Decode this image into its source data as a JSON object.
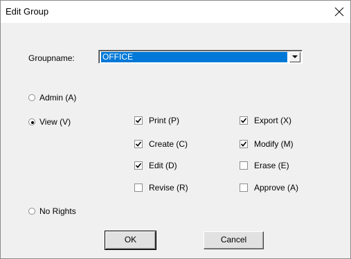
{
  "window": {
    "title": "Edit Group",
    "close_icon": "close-icon"
  },
  "groupname": {
    "label": "Groupname:",
    "selected_value": "OFFICE",
    "arrow_icon": "chevron-down-icon"
  },
  "rights": {
    "admin": {
      "label": "Admin (A)",
      "selected": false
    },
    "view": {
      "label": "View (V)",
      "selected": true
    },
    "no_rights": {
      "label": "No Rights",
      "selected": false
    }
  },
  "permissions": {
    "print": {
      "label": "Print (P)",
      "checked": true
    },
    "create": {
      "label": "Create (C)",
      "checked": true
    },
    "edit": {
      "label": "Edit (D)",
      "checked": true
    },
    "revise": {
      "label": "Revise (R)",
      "checked": false
    },
    "export": {
      "label": "Export (X)",
      "checked": true
    },
    "modify": {
      "label": "Modify (M)",
      "checked": true
    },
    "erase": {
      "label": "Erase (E)",
      "checked": false
    },
    "approve": {
      "label": "Approve (A)",
      "checked": false
    }
  },
  "buttons": {
    "ok_label": "OK",
    "cancel_label": "Cancel"
  },
  "colors": {
    "selection": "#0078d7",
    "dialog_bg": "#f0f0f0"
  }
}
